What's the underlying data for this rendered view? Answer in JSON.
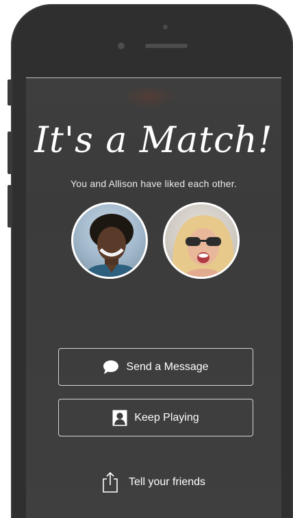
{
  "match": {
    "title": "It's a Match!",
    "subtitle": "You and Allison have liked each other."
  },
  "actions": {
    "send_message": "Send a Message",
    "keep_playing": "Keep Playing",
    "tell_friends": "Tell your friends"
  },
  "icons": {
    "send_message": "chat-bubble-icon",
    "keep_playing": "person-card-icon",
    "tell_friends": "share-icon"
  },
  "colors": {
    "screen_bg": "#3d3d3d",
    "text": "#ffffff",
    "button_border": "#d6d6d6"
  }
}
